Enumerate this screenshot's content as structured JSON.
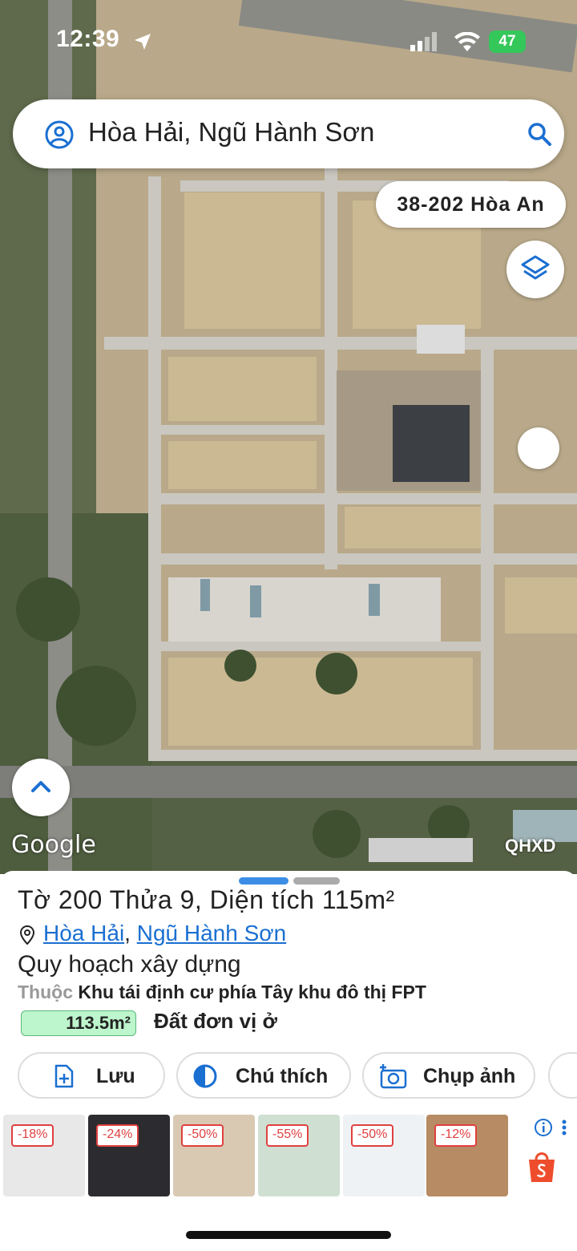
{
  "status_bar": {
    "time": "12:39",
    "battery": "47"
  },
  "search": {
    "text": "Hòa Hải, Ngũ Hành Sơn"
  },
  "map": {
    "address_chip": "38-202 Hòa An",
    "google_logo": "Google",
    "layer_label": "QHXD"
  },
  "parcel": {
    "title": "Tờ 200 Thửa 9, Diện tích 115m²",
    "address_links": [
      "Hòa Hải",
      "Ngũ Hành Sơn"
    ],
    "address_sep": ", ",
    "subtitle": "Quy hoạch xây dựng",
    "belongs_prefix": "Thuộc",
    "belongs_text": "Khu tái định cư phía Tây khu đô thị FPT",
    "area_value": "113.5m²",
    "area_color": "#bdf5cc",
    "land_type": "Đất đơn vị ở"
  },
  "actions": {
    "save": "Lưu",
    "legend": "Chú thích",
    "capture": "Chụp ảnh"
  },
  "ads": {
    "discounts": [
      "-18%",
      "-24%",
      "-50%",
      "-55%",
      "-50%",
      "-12%"
    ]
  },
  "colors": {
    "accent": "#1a6fd1",
    "shopee": "#ee4d2d"
  }
}
